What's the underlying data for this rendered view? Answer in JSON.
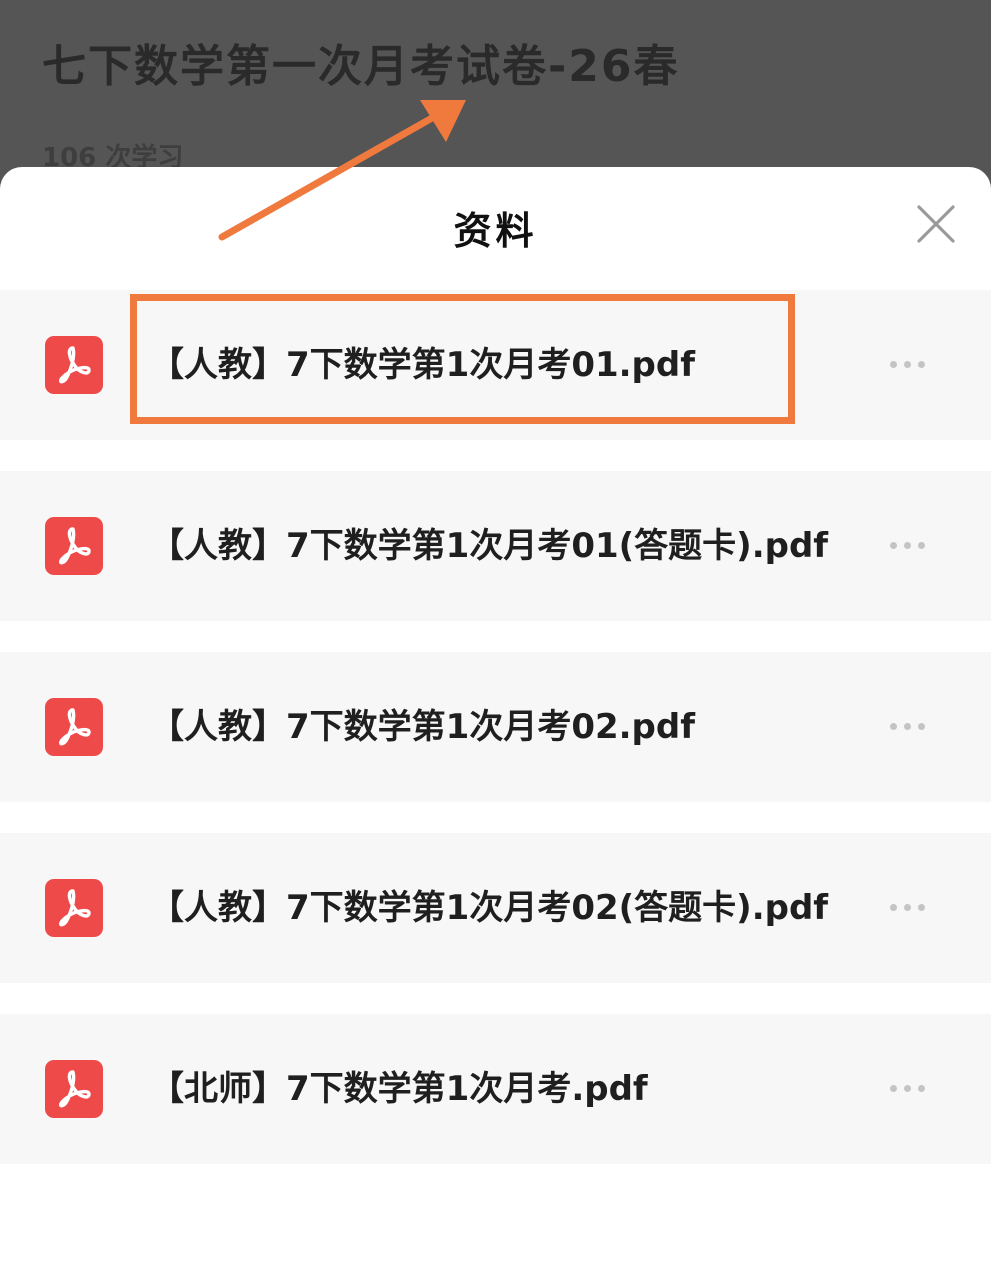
{
  "header": {
    "title": "七下数学第一次月考试卷-26春",
    "study_count": "106 次学习"
  },
  "sheet": {
    "title": "资料",
    "close_icon": "close-icon"
  },
  "files": [
    {
      "name": "【人教】7下数学第1次月考01.pdf",
      "icon": "pdf-icon"
    },
    {
      "name": "【人教】7下数学第1次月考01(答题卡).pdf",
      "icon": "pdf-icon"
    },
    {
      "name": "【人教】7下数学第1次月考02.pdf",
      "icon": "pdf-icon"
    },
    {
      "name": "【人教】7下数学第1次月考02(答题卡).pdf",
      "icon": "pdf-icon"
    },
    {
      "name": "【北师】7下数学第1次月考.pdf",
      "icon": "pdf-icon"
    }
  ],
  "colors": {
    "backdrop": "#555555",
    "pdf_icon": "#ef4a4a",
    "annotation": "#f07a3e",
    "row_background": "#f7f7f7"
  }
}
